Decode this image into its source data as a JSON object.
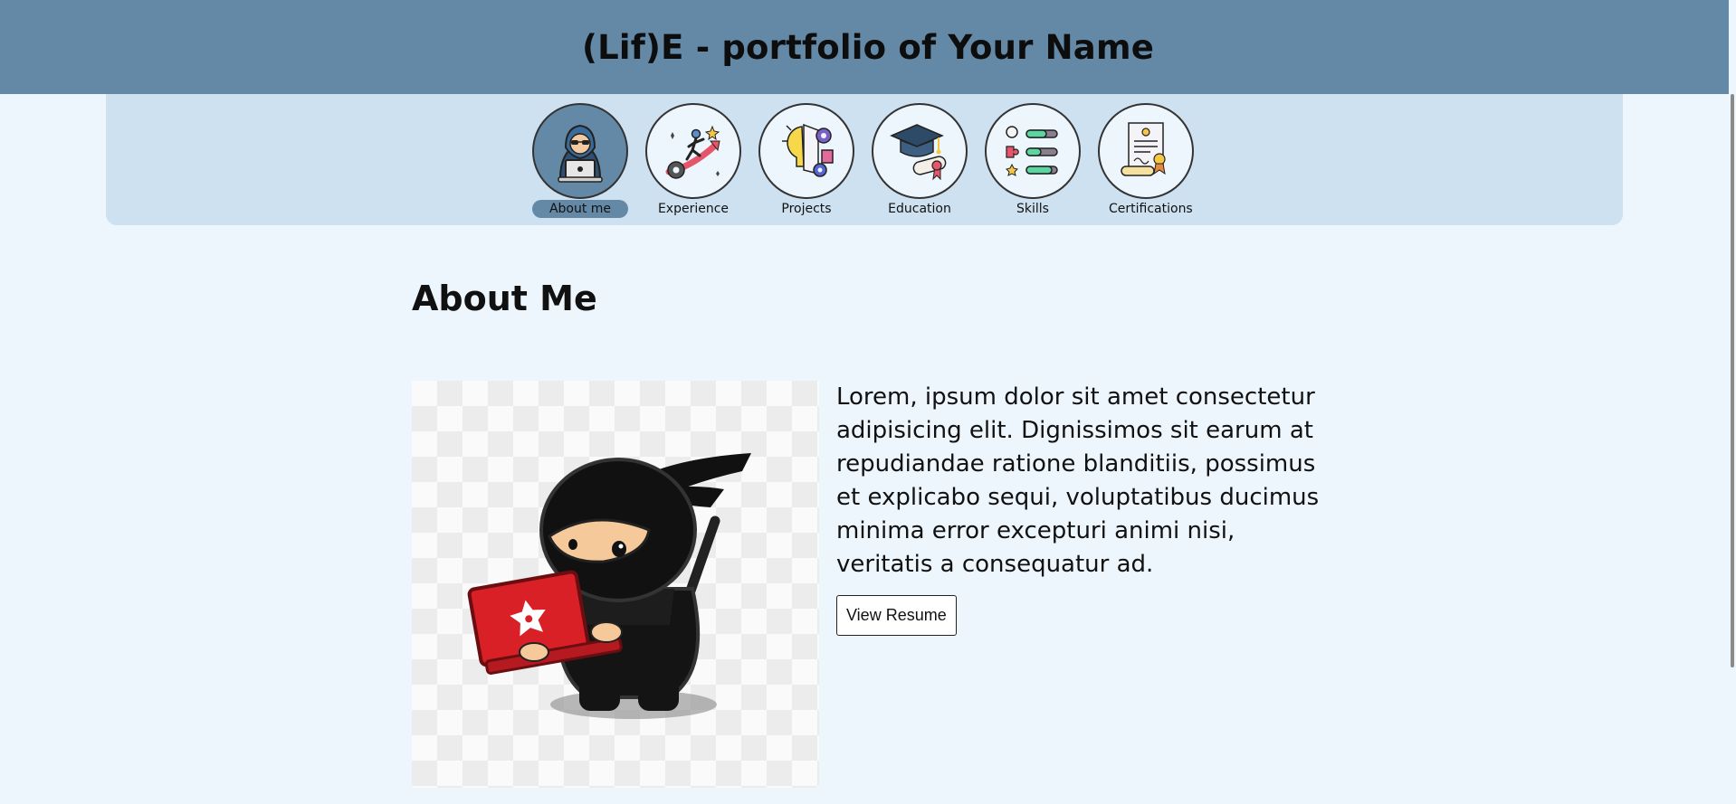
{
  "header": {
    "title": "(Lif)E - portfolio of Your Name"
  },
  "nav": {
    "items": [
      {
        "label": "About me",
        "icon": "hacker-laptop-icon",
        "active": true
      },
      {
        "label": "Experience",
        "icon": "career-climb-icon",
        "active": false
      },
      {
        "label": "Projects",
        "icon": "idea-gears-icon",
        "active": false
      },
      {
        "label": "Education",
        "icon": "graduation-cap-diploma-icon",
        "active": false
      },
      {
        "label": "Skills",
        "icon": "skill-bars-icon",
        "active": false
      },
      {
        "label": "Certifications",
        "icon": "certificate-icon",
        "active": false
      }
    ]
  },
  "about": {
    "title": "About Me",
    "image": "ninja-laptop-illustration",
    "bio": "Lorem, ipsum dolor sit amet consectetur adipisicing elit. Dignissimos sit earum at repudiandae ratione blanditiis, possimus et explicabo sequi, voluptatibus ducimus minima error excepturi animi nisi, veritatis a consequatur ad.",
    "button_label": "View Resume"
  },
  "colors": {
    "header_bg": "#6489a6",
    "nav_bg": "#cde1f1",
    "page_bg": "#eef6fd",
    "active_accent": "#6489a6"
  }
}
